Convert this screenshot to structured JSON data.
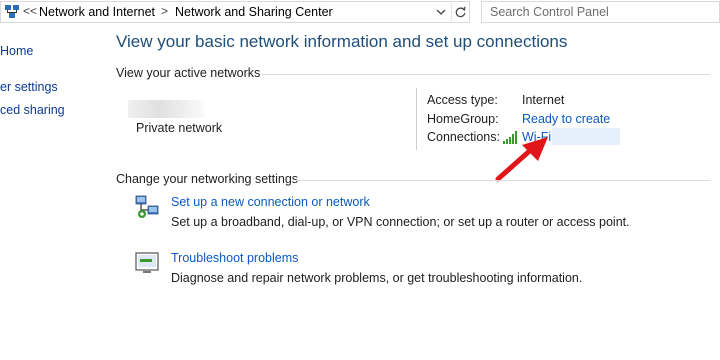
{
  "address_bar": {
    "overflow_chevron": "<<",
    "breadcrumbs": [
      "Network and Internet",
      "Network and Sharing Center"
    ],
    "separator": ">",
    "search_placeholder": "Search Control Panel"
  },
  "sidebar": {
    "items": [
      {
        "label": "Home"
      },
      {
        "label": "er settings"
      },
      {
        "label": "ced sharing"
      }
    ]
  },
  "main": {
    "title": "View your basic network information and set up connections",
    "active_networks_label": "View your active networks",
    "network_name": "Private network",
    "properties": {
      "access_type_label": "Access type:",
      "access_type_value": "Internet",
      "homegroup_label": "HomeGroup:",
      "homegroup_value": "Ready to create",
      "connections_label": "Connections:",
      "connections_value": "Wi-Fi"
    },
    "change_settings_label": "Change your networking settings",
    "tasks": [
      {
        "icon": "network-setup-icon",
        "link": "Set up a new connection or network",
        "description": "Set up a broadband, dial-up, or VPN connection; or set up a router or access point."
      },
      {
        "icon": "troubleshoot-icon",
        "link": "Troubleshoot problems",
        "description": "Diagnose and repair network problems, or get troubleshooting information."
      }
    ]
  },
  "colors": {
    "title": "#1e4e79",
    "link": "#0b5ac2",
    "annotation_arrow": "#e0161b"
  }
}
